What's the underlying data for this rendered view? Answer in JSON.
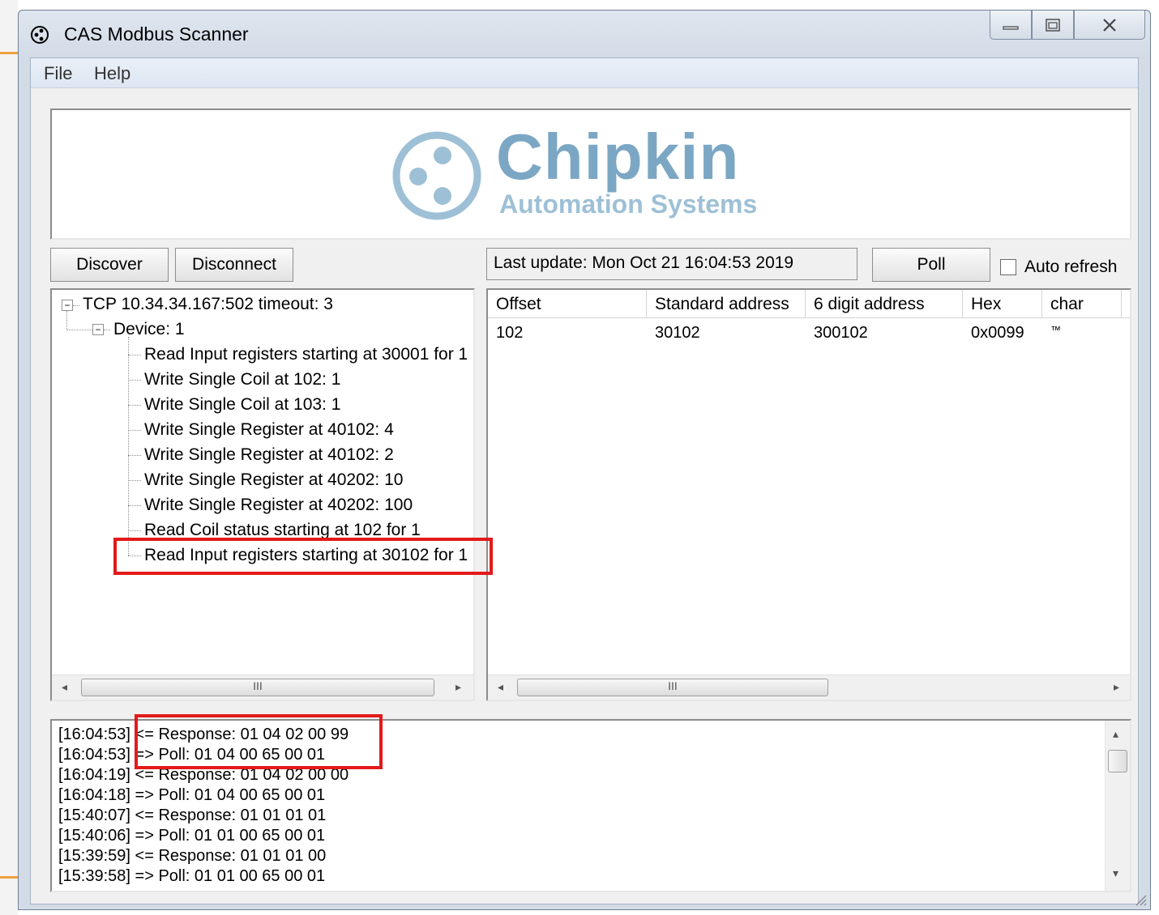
{
  "window": {
    "title": "CAS Modbus Scanner",
    "colors": {
      "accent_red": "#e31a1a",
      "logo_blue": "#7ba7c4"
    }
  },
  "menu": {
    "items": [
      "File",
      "Help"
    ]
  },
  "logo": {
    "name": "Chipkin",
    "subtitle": "Automation Systems"
  },
  "toolbar": {
    "discover": "Discover",
    "disconnect": "Disconnect",
    "last_update": "Last update: Mon Oct 21 16:04:53 2019",
    "poll": "Poll",
    "auto_refresh": "Auto refresh",
    "auto_refresh_checked": false
  },
  "tree": {
    "root": "TCP 10.34.34.167:502 timeout: 3",
    "device": "Device: 1",
    "items": [
      "Read Input registers starting at 30001 for 1",
      "Write Single Coil at 102: 1",
      "Write Single Coil at 103: 1",
      "Write Single Register at 40102: 4",
      "Write Single Register at 40102: 2",
      "Write Single Register at 40202: 10",
      "Write Single Register at 40202: 100",
      "Read Coil status starting at 102 for 1",
      "Read Input registers starting at 30102 for 1"
    ]
  },
  "grid": {
    "columns": [
      "Offset",
      "Standard address",
      "6 digit address",
      "Hex",
      "char"
    ],
    "rows": [
      [
        "102",
        "30102",
        "300102",
        "0x0099",
        "™"
      ]
    ]
  },
  "scroll": {
    "thumb_glyph": "III"
  },
  "log": {
    "lines": [
      "[16:04:53] <= Response: 01 04 02 00 99",
      "[16:04:53] => Poll: 01 04 00 65 00 01",
      "[16:04:19] <= Response: 01 04 02 00 00",
      "[16:04:18] => Poll: 01 04 00 65 00 01",
      "[15:40:07] <= Response: 01 01 01 01",
      "[15:40:06] => Poll: 01 01 00 65 00 01",
      "[15:39:59] <= Response: 01 01 01 00",
      "[15:39:58] => Poll: 01 01 00 65 00 01"
    ]
  }
}
